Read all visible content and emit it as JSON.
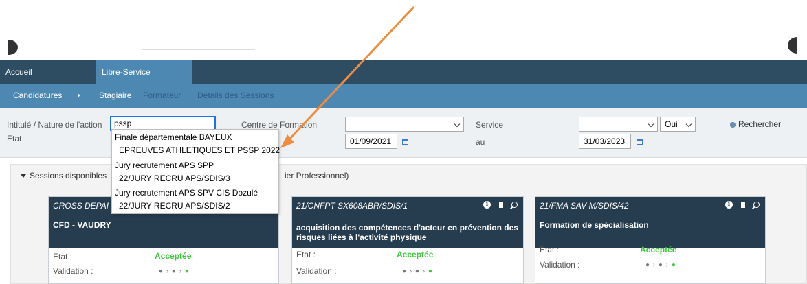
{
  "nav": {
    "tabs": [
      "Accueil",
      "Libre-Service"
    ]
  },
  "subnav": {
    "candidatures": "Candidatures",
    "stagiaire": "Stagiaire",
    "formateur": "Formateur",
    "details": "Détails des Sessions"
  },
  "filters": {
    "intitule_label": "Intitulé / Nature de l'action",
    "intitule_value": "pssp",
    "etat_label": "Etat",
    "centre_label": "Centre de Formation",
    "centre_value": "",
    "date_from": "01/09/2021",
    "service_label": "Service",
    "service_value": "",
    "au_label": "au",
    "date_to": "31/03/2023",
    "oui_value": "Oui",
    "search_label": "Rechercher"
  },
  "autocomplete": {
    "items": [
      "Finale départementale BAYEUX",
      "EPREUVES ATHLETIQUES ET PSSP 2022",
      "Jury recrutement APS SPP",
      "22/JURY RECRU APS/SDIS/3",
      "Jury recrutement APS SPV CIS Dozulé",
      "22/JURY RECRU APS/SDIS/2"
    ]
  },
  "panel": {
    "title_left": "Sessions disponibles",
    "title_right": "ier Professionnel)"
  },
  "cards": [
    {
      "code": "CROSS DEPAI",
      "name": "CFD - VAUDRY",
      "etat_label": "Etat :",
      "etat": "Acceptée",
      "validation_label": "Validation :"
    },
    {
      "code": "21/CNFPT SX608ABR/SDIS/1",
      "name": "acquisition des compétences d'acteur en prévention des risques liées à l'activité physique",
      "etat_label": "Etat :",
      "etat": "Acceptée",
      "validation_label": "Validation :"
    },
    {
      "code": "21/FMA SAV M/SDIS/42",
      "name": "Formation de spécialisation",
      "etat_label": "Etat :",
      "etat": "Acceptée",
      "validation_label": "Validation :"
    }
  ],
  "colors": {
    "nav_dark": "#2e4c62",
    "nav_light": "#4d88b3",
    "card_head": "#263d4f",
    "accepted": "#3cc83c",
    "arrow": "#f28c3c"
  }
}
